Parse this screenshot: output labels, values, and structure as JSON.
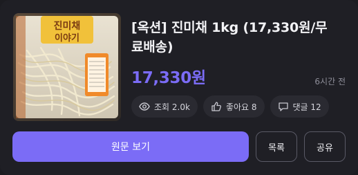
{
  "post": {
    "title": "[옥션] 진미채 1kg (17,330원/무료배송)",
    "price": "17,330원",
    "time_ago": "6시간 전",
    "thumbnail_alt": "진미채 상품 이미지",
    "thumbnail_text": "이야기"
  },
  "stats": {
    "views_label": "조회 2.0k",
    "likes_label": "좋아요 8",
    "comments_label": "댓글 12"
  },
  "actions": {
    "view_original_label": "원문 보기",
    "list_label": "목록",
    "share_label": "공유"
  },
  "colors": {
    "accent": "#7b6cf6",
    "background": "#1f1f25",
    "pill_bg": "#2a2a31"
  },
  "icons": {
    "views": "eye-icon",
    "likes": "thumbs-up-icon",
    "comments": "comment-icon"
  }
}
